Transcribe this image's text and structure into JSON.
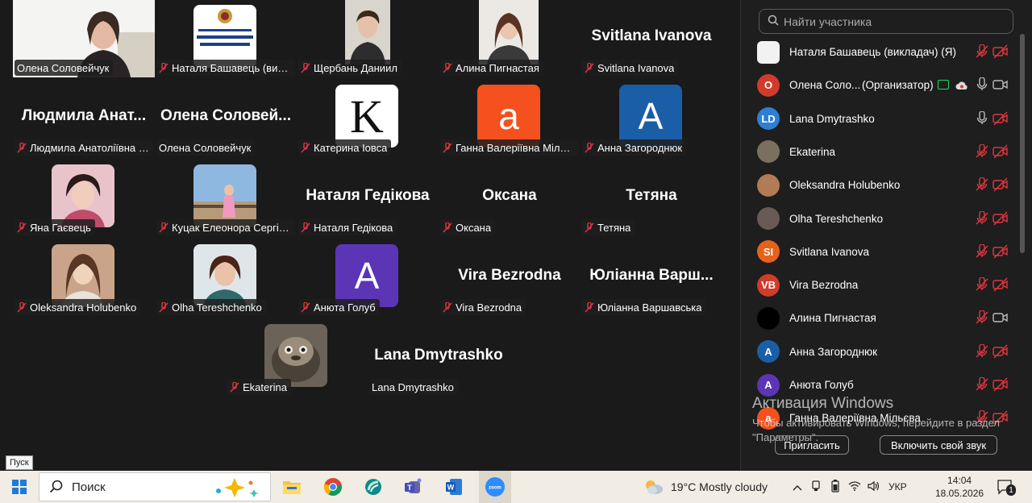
{
  "gallery": {
    "tiles": [
      {
        "caption": "Олена Соловейчук"
      },
      {
        "caption": "Наталя Башавець (викл..."
      },
      {
        "caption": "Щербань Даниил"
      },
      {
        "caption": "Алина Пигнастая"
      },
      {
        "caption": "Svitlana Ivanova",
        "bigname": "Svitlana Ivanova"
      },
      {
        "caption": "Людмила Анатоліївна К...",
        "bigname": "Людмила Анат..."
      },
      {
        "caption": "Олена Соловейчук",
        "bigname": "Олена Соловей..."
      },
      {
        "caption": "Катерина Іовса",
        "letter": "K"
      },
      {
        "caption": "Ганна Валеріївна Мільєва",
        "letter": "a"
      },
      {
        "caption": "Анна Загороднюк",
        "letter": "A"
      },
      {
        "caption": "Яна Гаєвець"
      },
      {
        "caption": "Куцак Елеонора Сергіївна"
      },
      {
        "caption": "Наталя Гедікова",
        "bigname": "Наталя Гедікова"
      },
      {
        "caption": "Оксана",
        "bigname": "Оксана"
      },
      {
        "caption": "Тетяна",
        "bigname": "Тетяна"
      },
      {
        "caption": "Oleksandra Holubenko"
      },
      {
        "caption": "Olha Tereshchenko"
      },
      {
        "caption": "Анюта Голуб",
        "letter": "A"
      },
      {
        "caption": "Vira Bezrodna",
        "bigname": "Vira Bezrodna"
      },
      {
        "caption": "Юліанна Варшавська",
        "bigname": "Юліанна Варш..."
      },
      {
        "caption": "Ekaterina"
      },
      {
        "caption": "Lana Dmytrashko",
        "bigname": "Lana Dmytrashko"
      }
    ]
  },
  "panel": {
    "search_placeholder": "Найти участника",
    "participants": [
      {
        "name": "Наталя Башавець (викладач) (Я)",
        "initials": "",
        "color": "#f2f2f2"
      },
      {
        "name": "Олена Соло...",
        "role": "(Организатор)",
        "initials": "О",
        "color": "#d13b2c"
      },
      {
        "name": "Lana Dmytrashko",
        "initials": "LD",
        "color": "#2d7fd3"
      },
      {
        "name": "Ekaterina",
        "initials": "",
        "color": "#7a7060"
      },
      {
        "name": "Oleksandra Holubenko",
        "initials": "",
        "color": "#b37a56"
      },
      {
        "name": "Olha Tereshchenko",
        "initials": "",
        "color": "#6a5a55"
      },
      {
        "name": "Svitlana Ivanova",
        "initials": "SI",
        "color": "#e5621a"
      },
      {
        "name": "Vira Bezrodna",
        "initials": "VB",
        "color": "#d13b2c"
      },
      {
        "name": "Алина Пигнастая",
        "initials": "",
        "color": "#000000"
      },
      {
        "name": "Анна Загороднюк",
        "initials": "A",
        "color": "#1b5ea8"
      },
      {
        "name": "Анюта Голуб",
        "initials": "A",
        "color": "#5b35b5"
      },
      {
        "name": "Ганна Валеріївна Мільєва",
        "initials": "a",
        "color": "#f4511e"
      }
    ],
    "activation_title": "Активация Windows",
    "activation_text": "Чтобы активировать Windows, перейдите в раздел \"Параметры\".",
    "invite_label": "Пригласить",
    "unmute_label": "Включить свой звук"
  },
  "taskbar": {
    "tooltip": "Пуск",
    "search_placeholder": "Поиск",
    "weather": "19°C  Mostly cloudy",
    "lang": "УКР",
    "time": "14:04",
    "date": "18.05.2026",
    "notifications": "1"
  },
  "colors": {
    "active_border": "#23d959",
    "muted_red": "#e0373e",
    "letter_k_bg": "#ffffff",
    "letter_a_orange": "#f4511e",
    "letter_a_blue": "#1b5ea8",
    "letter_a_purple": "#5b35b5"
  }
}
